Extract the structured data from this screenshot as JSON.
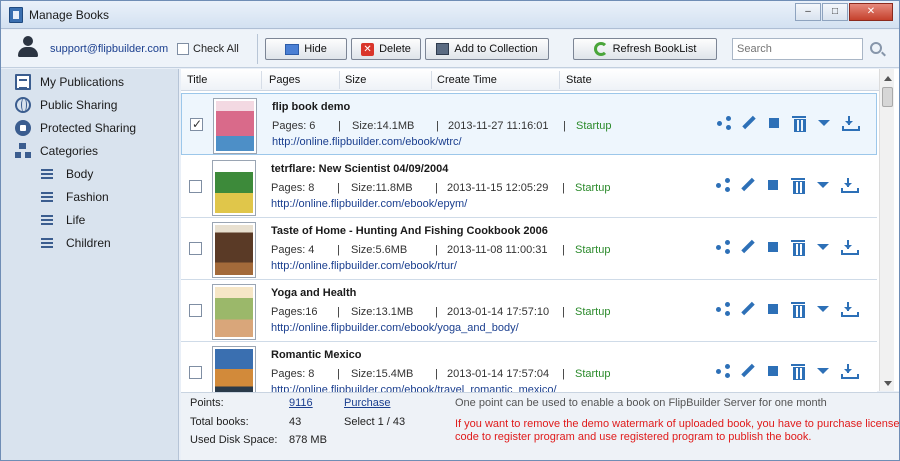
{
  "window": {
    "title": "Manage Books",
    "minimize": "–",
    "maximize": "□",
    "close": "✕"
  },
  "toolbar": {
    "email": "support@flipbuilder.com",
    "check_all": "Check All",
    "hide": "Hide",
    "delete": "Delete",
    "add_to_collection": "Add to Collection",
    "refresh": "Refresh BookList",
    "search_placeholder": "Search"
  },
  "sidebar": {
    "items": [
      {
        "label": "My Publications",
        "icon": "publications-icon"
      },
      {
        "label": "Public Sharing",
        "icon": "globe-icon"
      },
      {
        "label": "Protected Sharing",
        "icon": "lock-icon"
      },
      {
        "label": "Categories",
        "icon": "categories-icon"
      }
    ],
    "categories": [
      "Body",
      "Fashion",
      "Life",
      "Children"
    ]
  },
  "columns": [
    "Title",
    "Pages",
    "Size",
    "Create Time",
    "State"
  ],
  "books": [
    {
      "title": "flip book demo",
      "pages": "Pages: 6",
      "size": "Size:14.1MB",
      "time": "2013-11-27 11:16:01",
      "state": "Startup",
      "url": "http://online.flipbuilder.com/ebook/wtrc/",
      "checked": true,
      "cover": "#d96a8a"
    },
    {
      "title": "tetrflare: New Scientist  04/09/2004",
      "pages": "Pages: 8",
      "size": "Size:11.8MB",
      "time": "2013-11-15 12:05:29",
      "state": "Startup",
      "url": "http://online.flipbuilder.com/ebook/epym/",
      "checked": false,
      "cover": "#3d8a3a"
    },
    {
      "title": "Taste of Home - Hunting And Fishing Cookbook 2006",
      "pages": "Pages: 4",
      "size": "Size:5.6MB",
      "time": "2013-11-08 11:00:31",
      "state": "Startup",
      "url": "http://online.flipbuilder.com/ebook/rtur/",
      "checked": false,
      "cover": "#5a3a26"
    },
    {
      "title": "Yoga and Health",
      "pages": "Pages:16",
      "size": "Size:13.1MB",
      "time": "2013-01-14 17:57:10",
      "state": "Startup",
      "url": "http://online.flipbuilder.com/ebook/yoga_and_body/",
      "checked": false,
      "cover": "#9bb86a"
    },
    {
      "title": "Romantic Mexico",
      "pages": "Pages: 8",
      "size": "Size:15.4MB",
      "time": "2013-01-14 17:57:04",
      "state": "Startup",
      "url": "http://online.flipbuilder.com/ebook/travel_romantic_mexico/",
      "checked": false,
      "cover": "#d28a3a"
    }
  ],
  "footer": {
    "points_label": "Points:",
    "points_value": "9116",
    "purchase": "Purchase",
    "point_note": "One point can be used to enable a book on FlipBuilder Server for one month",
    "total_label": "Total books:",
    "total_value": "43",
    "select": "Select 1 / 43",
    "disk_label": "Used Disk Space:",
    "disk_value": "878 MB",
    "warning_1": "If you want to remove the demo watermark of uploaded book, you have to purchase license",
    "warning_2": "code to register program and use registered program to publish the book."
  },
  "colors": {
    "link": "#1b3f8f",
    "state": "#2b8a2b",
    "warning": "#e01b1b",
    "action": "#2d70b7"
  }
}
